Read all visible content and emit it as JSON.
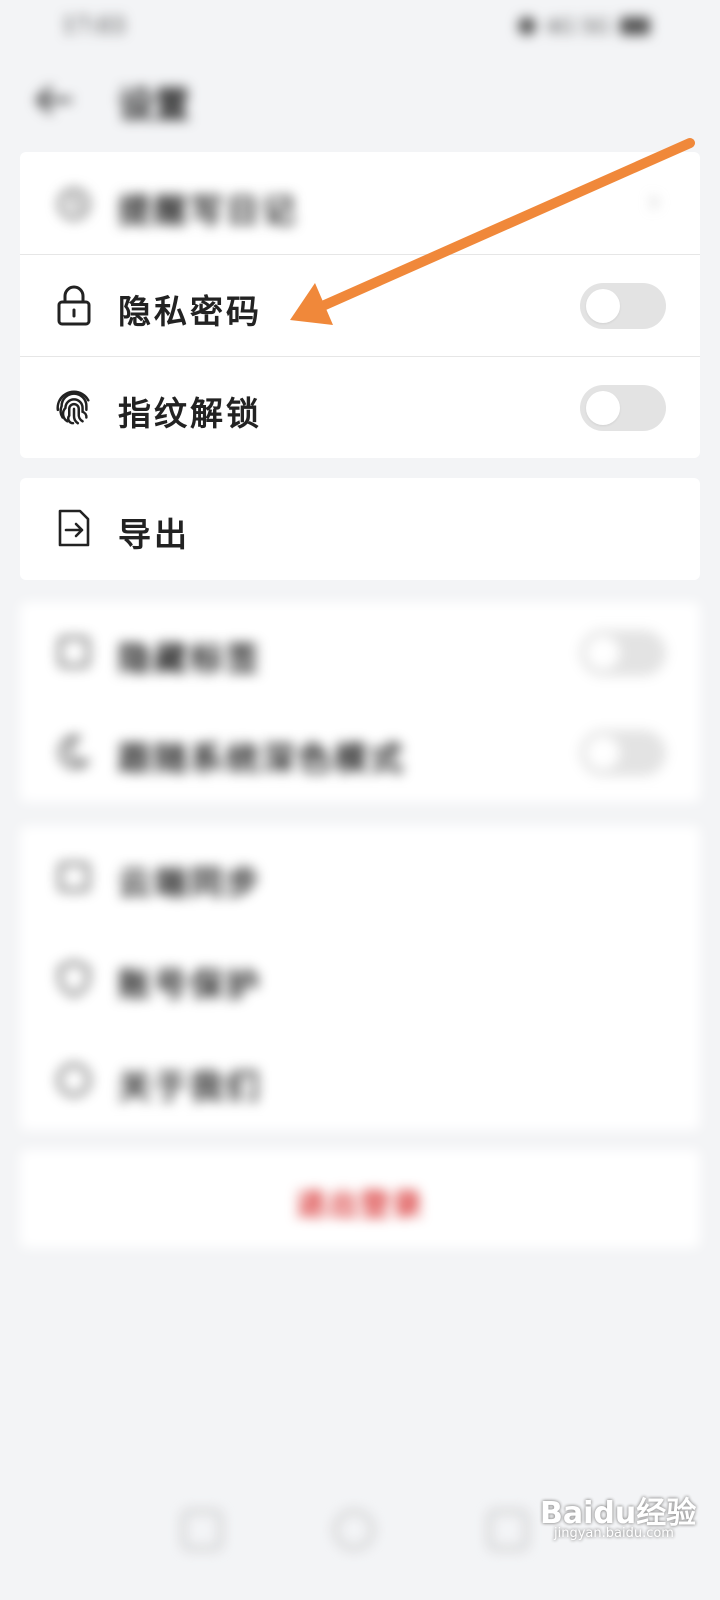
{
  "status_bar": {
    "time": "17:03",
    "indicators": "4G 5G"
  },
  "header": {
    "title": "设置"
  },
  "sections": {
    "reminder": {
      "label": "提醒写日记"
    },
    "privacy_password": {
      "label": "隐私密码",
      "enabled": false
    },
    "fingerprint_unlock": {
      "label": "指纹解锁",
      "enabled": false
    },
    "export": {
      "label": "导出"
    },
    "hide_tags": {
      "label": "隐藏标签",
      "enabled": false
    },
    "follow_dark_mode": {
      "label": "跟随系统深色模式",
      "enabled": false
    },
    "cloud_sync": {
      "label": "云端同步"
    },
    "account_security": {
      "label": "账号保护"
    },
    "about": {
      "label": "关于我们"
    },
    "logout": {
      "label": "退出登录"
    }
  },
  "annotation": {
    "color": "#f0883a",
    "points_to": "privacy_password"
  },
  "watermark": {
    "text": "Baidu经验",
    "sub": "jingyan.baidu.com"
  },
  "icons": {
    "back": "back-arrow-icon",
    "reminder": "alarm-clock-icon",
    "privacy_password": "lock-icon",
    "fingerprint_unlock": "fingerprint-icon",
    "export": "export-file-icon"
  }
}
